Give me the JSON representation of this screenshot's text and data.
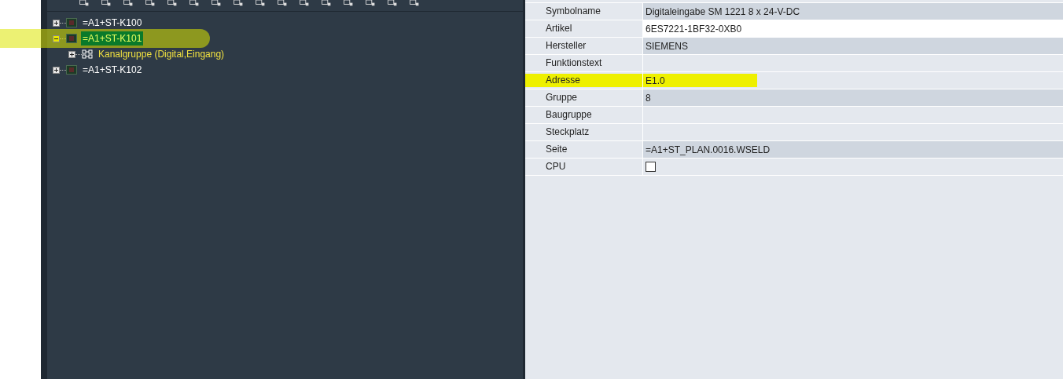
{
  "tree": {
    "nodes": [
      {
        "label": "=A1+ST-K100",
        "expanded": false,
        "selected": false,
        "highlighted": false,
        "kind": "device"
      },
      {
        "label": "=A1+ST-K101",
        "expanded": true,
        "selected": true,
        "highlighted": true,
        "kind": "device",
        "children": [
          {
            "label": "Kanalgruppe (Digital,Eingang)",
            "expanded": false,
            "selected": false,
            "highlighted": false,
            "kind": "group"
          }
        ]
      },
      {
        "label": "=A1+ST-K102",
        "expanded": false,
        "selected": false,
        "highlighted": false,
        "kind": "device"
      }
    ]
  },
  "properties": [
    {
      "name": "Symbolname",
      "value": "Digitaleingabe SM 1221 8 x 24-V-DC",
      "kind": "readonly",
      "highlighted": false
    },
    {
      "name": "Artikel",
      "value": "6ES7221-1BF32-0XB0",
      "kind": "editing",
      "highlighted": false
    },
    {
      "name": "Hersteller",
      "value": "SIEMENS",
      "kind": "readonly",
      "highlighted": false
    },
    {
      "name": "Funktionstext",
      "kind": "text",
      "highlighted": false
    },
    {
      "name": "Adresse",
      "value": "E1.0",
      "kind": "text",
      "highlighted": true
    },
    {
      "name": "Gruppe",
      "value": "8",
      "kind": "readonly",
      "highlighted": false
    },
    {
      "name": "Baugruppe",
      "kind": "text",
      "highlighted": false
    },
    {
      "name": "Steckplatz",
      "kind": "text",
      "highlighted": false
    },
    {
      "name": "Seite",
      "value": "=A1+ST_PLAN.0016.WSELD",
      "kind": "readonly",
      "highlighted": false
    },
    {
      "name": "CPU",
      "kind": "checkbox",
      "checked": false,
      "highlighted": false
    }
  ]
}
